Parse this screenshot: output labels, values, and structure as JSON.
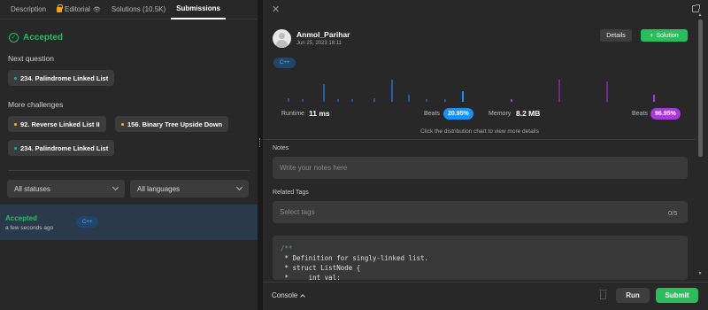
{
  "tabs": [
    {
      "label": "Description"
    },
    {
      "label": "Editorial"
    },
    {
      "label": "Solutions (10.5K)"
    },
    {
      "label": "Submissions",
      "active": true
    }
  ],
  "left": {
    "status": "Accepted",
    "next_question_label": "Next question",
    "next_question": "234. Palindrome Linked List",
    "more_challenges_label": "More challenges",
    "challenges": [
      {
        "title": "92. Reverse Linked List II",
        "difficulty": "medium"
      },
      {
        "title": "156. Binary Tree Upside Down",
        "difficulty": "medium"
      },
      {
        "title": "234. Palindrome Linked List",
        "difficulty": "easy"
      }
    ],
    "filters": {
      "status": "All statuses",
      "language": "All languages"
    },
    "submission": {
      "status": "Accepted",
      "time": "a few seconds ago",
      "lang": "C++"
    }
  },
  "right": {
    "user": {
      "name": "Anmol_Parihar",
      "date": "Jun 25, 2023 18:11"
    },
    "details_label": "Details",
    "solution_label": "Solution",
    "lang": "C++",
    "runtime": {
      "label": "Runtime",
      "value": "11 ms",
      "beats_label": "Beats",
      "beats": "20.95%"
    },
    "memory": {
      "label": "Memory",
      "value": "8.2 MB",
      "beats_label": "Beats",
      "beats": "96.95%"
    },
    "hint": "Click the distribution chart to view more details",
    "notes_label": "Notes",
    "notes_placeholder": "Write your notes here",
    "tags_label": "Related Tags",
    "tags_placeholder": "Select tags",
    "tags_count": "0/5",
    "code": [
      "/**",
      " * Definition for singly-linked list.",
      " * struct ListNode {",
      " *     int val;"
    ],
    "console_label": "Console",
    "run_label": "Run",
    "submit_label": "Submit"
  },
  "colors": {
    "accent_green": "#2cbb5d",
    "blue": "#1a90ff",
    "purple": "#a838d8",
    "highlight_row": "#2a3a4a"
  }
}
